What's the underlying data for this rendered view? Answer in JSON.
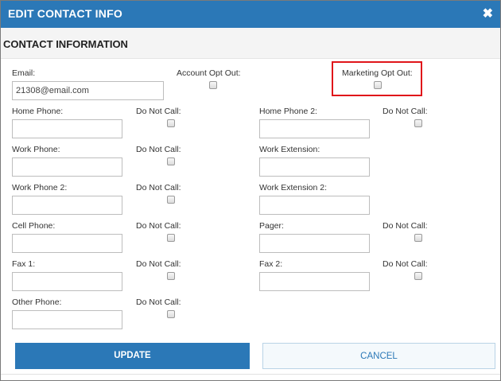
{
  "dialog": {
    "title": "EDIT CONTACT INFO",
    "close_icon": "close-icon",
    "section_title": "CONTACT INFORMATION"
  },
  "fields": {
    "email": {
      "label": "Email:",
      "value": "21308@email.com"
    },
    "account_opt_out": {
      "label": "Account Opt Out:"
    },
    "marketing_opt_out": {
      "label": "Marketing Opt Out:"
    },
    "home_phone": {
      "label": "Home Phone:",
      "value": ""
    },
    "home_phone_2": {
      "label": "Home Phone 2:",
      "value": ""
    },
    "work_phone": {
      "label": "Work Phone:",
      "value": ""
    },
    "work_extension": {
      "label": "Work Extension:",
      "value": ""
    },
    "work_phone_2": {
      "label": "Work Phone 2:",
      "value": ""
    },
    "work_extension_2": {
      "label": "Work Extension 2:",
      "value": ""
    },
    "cell_phone": {
      "label": "Cell Phone:",
      "value": ""
    },
    "pager": {
      "label": "Pager:",
      "value": ""
    },
    "fax_1": {
      "label": "Fax 1:",
      "value": ""
    },
    "fax_2": {
      "label": "Fax 2:",
      "value": ""
    },
    "other_phone": {
      "label": "Other Phone:",
      "value": ""
    }
  },
  "do_not_call_label": "Do Not Call:",
  "buttons": {
    "update": "UPDATE",
    "cancel": "CANCEL"
  },
  "colors": {
    "header": "#2b78b7",
    "highlight": "#e0151a"
  }
}
